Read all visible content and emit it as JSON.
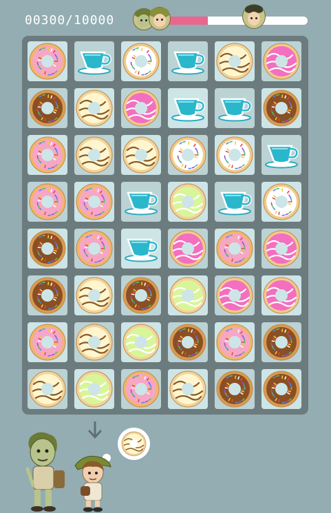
{
  "hud": {
    "score_text": "00300/10000",
    "progress_fraction": 0.43,
    "left_avatar": "zombie-duo-avatar",
    "right_avatar": "hat-girl-avatar",
    "fill_color": "#e8678f",
    "track_color": "#ffffff"
  },
  "board": {
    "rows": 8,
    "cols": 6,
    "tiles": [
      [
        "donut-pink",
        "teacup",
        "donut-white",
        "teacup",
        "donut-vanilla",
        "donut-magenta"
      ],
      [
        "donut-chocolate",
        "donut-vanilla",
        "donut-magenta",
        "teacup",
        "teacup",
        "donut-chocolate"
      ],
      [
        "donut-pink",
        "donut-vanilla",
        "donut-vanilla",
        "donut-white",
        "donut-white",
        "teacup"
      ],
      [
        "donut-pink",
        "donut-pink",
        "teacup",
        "donut-green",
        "teacup",
        "donut-white"
      ],
      [
        "donut-chocolate",
        "donut-pink",
        "teacup",
        "donut-magenta",
        "donut-pink",
        "donut-magenta"
      ],
      [
        "donut-chocolate",
        "donut-vanilla",
        "donut-chocolate",
        "donut-green",
        "donut-magenta",
        "donut-magenta"
      ],
      [
        "donut-pink",
        "donut-vanilla",
        "donut-green",
        "donut-chocolate",
        "donut-pink",
        "donut-chocolate"
      ],
      [
        "donut-vanilla",
        "donut-green",
        "donut-pink",
        "donut-vanilla",
        "donut-chocolate",
        "donut-chocolate"
      ]
    ]
  },
  "hint": {
    "arrow_icon": "arrow-down-icon",
    "target_item": "donut-vanilla"
  },
  "characters": [
    "zombie-boy",
    "hat-girl"
  ]
}
